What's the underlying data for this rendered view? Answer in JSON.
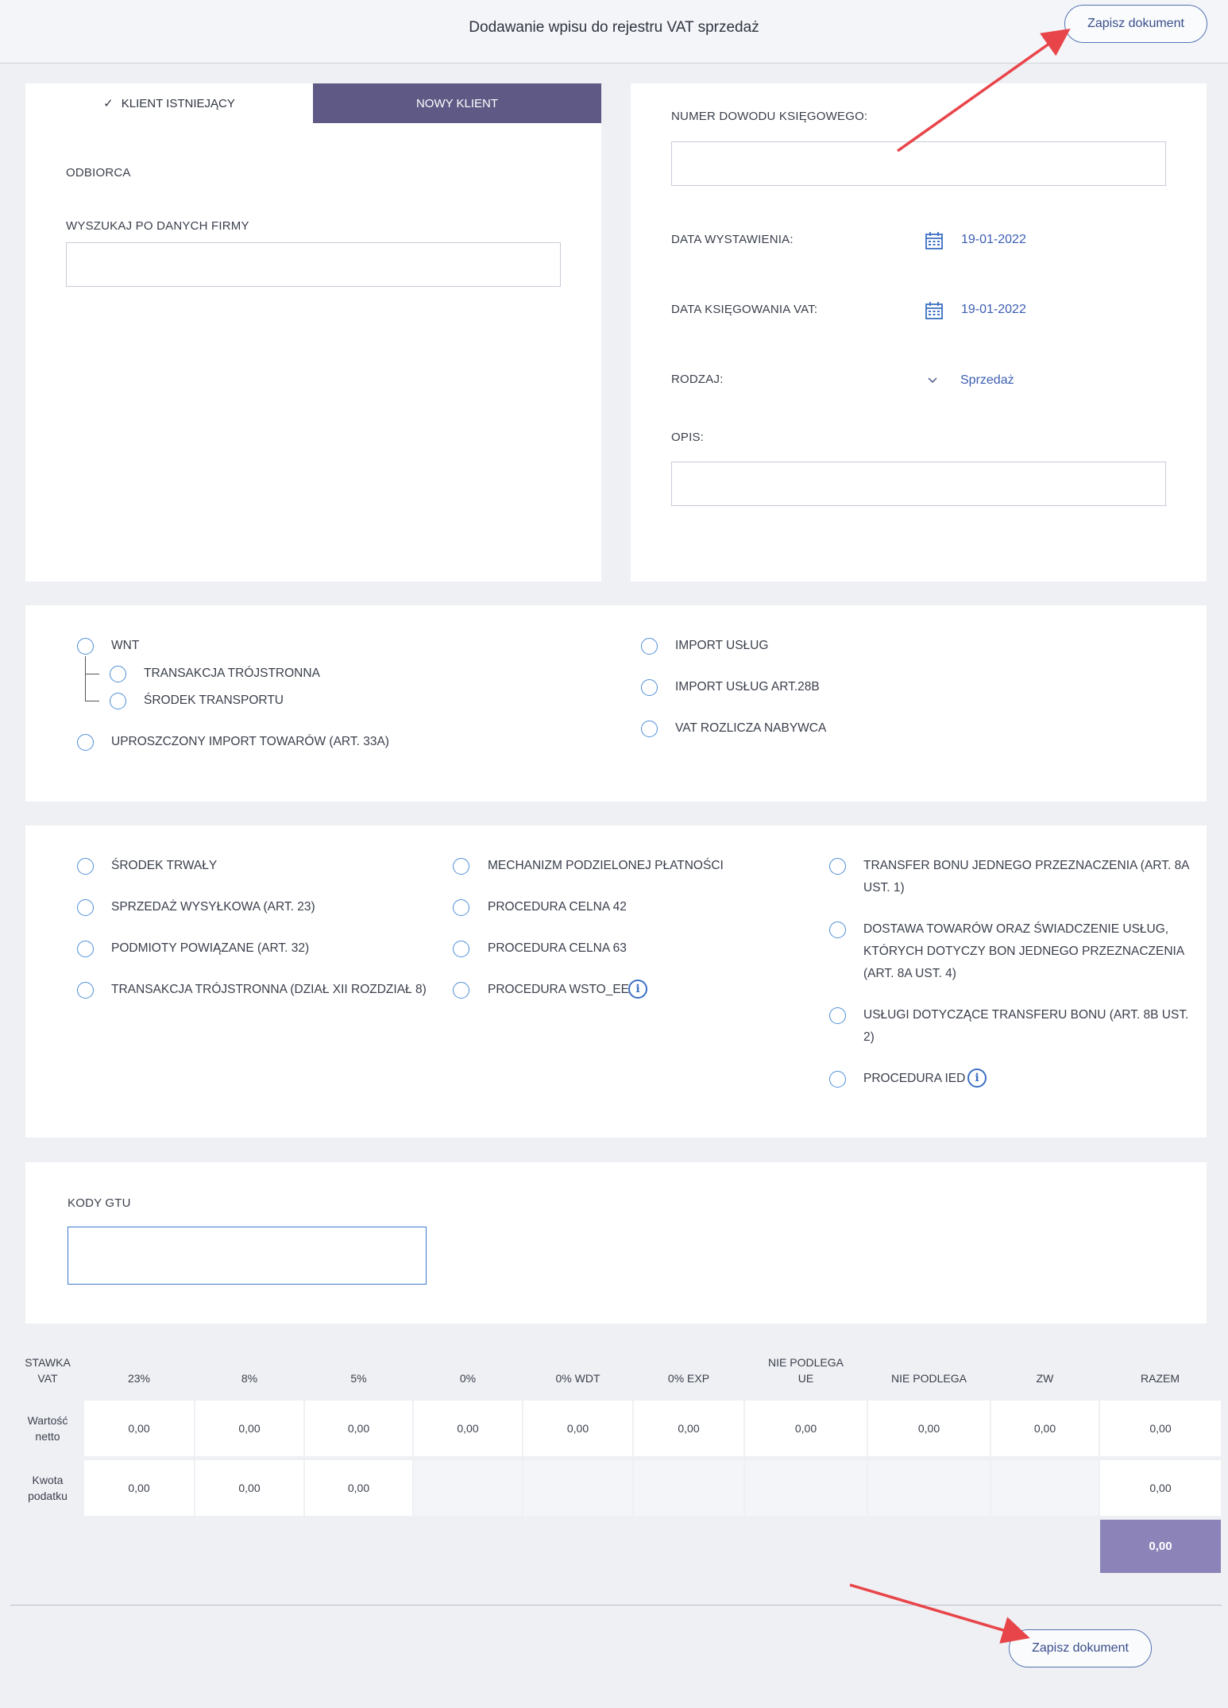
{
  "header": {
    "title": "Dodawanie wpisu do rejestru VAT sprzedaż",
    "save_label": "Zapisz dokument"
  },
  "client_card": {
    "tab_existing": "KLIENT ISTNIEJĄCY",
    "tab_existing_check": "✓",
    "tab_new": "NOWY KLIENT",
    "recipient_label": "ODBIORCA",
    "search_label": "WYSZUKAJ PO DANYCH FIRMY",
    "search_value": ""
  },
  "document_card": {
    "doc_number_label": "NUMER DOWODU KSIĘGOWEGO:",
    "doc_number_value": "",
    "issue_date_label": "DATA WYSTAWIENIA:",
    "issue_date_value": "19-01-2022",
    "vat_date_label": "DATA KSIĘGOWANIA VAT:",
    "vat_date_value": "19-01-2022",
    "type_label": "RODZAJ:",
    "type_value": "Sprzedaż",
    "description_label": "OPIS:",
    "description_value": ""
  },
  "transaction_options": {
    "wnt": "WNT",
    "triangular": "TRANSAKCJA TRÓJSTRONNA",
    "transport": "ŚRODEK TRANSPORTU",
    "simplified_import": "UPROSZCZONY IMPORT TOWARÓW (ART. 33A)",
    "import_services": "IMPORT USŁUG",
    "import_services_28b": "IMPORT USŁUG ART.28B",
    "reverse_charge": "VAT ROZLICZA NABYWCA"
  },
  "flags": {
    "col1": [
      "ŚRODEK TRWAŁY",
      "SPRZEDAŻ WYSYŁKOWA (ART. 23)",
      "PODMIOTY POWIĄZANE (ART. 32)",
      "TRANSAKCJA TRÓJSTRONNA (DZIAŁ XII ROZDZIAŁ 8)"
    ],
    "col2": [
      "MECHANIZM PODZIELONEJ PŁATNOŚCI",
      "PROCEDURA CELNA 42",
      "PROCEDURA CELNA 63",
      "PROCEDURA WSTO_EE"
    ],
    "col3": [
      "TRANSFER BONU JEDNEGO PRZEZNACZENIA (ART. 8A",
      "UST. 1)",
      "DOSTAWA TOWARÓW ORAZ ŚWIADCZENIE USŁUG,",
      "KTÓRYCH DOTYCZY BON JEDNEGO PRZEZNACZENIA",
      "(ART. 8A UST. 4)",
      "USŁUGI DOTYCZĄCE TRANSFERU BONU (ART. 8B UST.",
      "2)",
      "PROCEDURA IED"
    ],
    "info_glyph": "i"
  },
  "gtu": {
    "label": "KODY GTU",
    "value": ""
  },
  "vat_table": {
    "row_header_rate": [
      "STAWKA",
      "VAT"
    ],
    "columns": [
      "23%",
      "8%",
      "5%",
      "0%",
      "0% WDT",
      "0% EXP",
      "NIE PODLEGA",
      "UE",
      "NIE PODLEGA",
      "ZW",
      "RAZEM"
    ],
    "net_label": [
      "Wartość",
      "netto"
    ],
    "tax_label": [
      "Kwota",
      "podatku"
    ],
    "net_values": [
      "0,00",
      "0,00",
      "0,00",
      "0,00",
      "0,00",
      "0,00",
      "0,00",
      "0,00",
      "0,00",
      "0,00"
    ],
    "tax_values": [
      "0,00",
      "0,00",
      "0,00",
      "0,00"
    ],
    "grand_total": "0,00"
  },
  "colors": {
    "accent": "#5f5a85",
    "link": "#3b5db1",
    "radio": "#4d8ed8",
    "annotation_arrow": "#e8454a"
  }
}
